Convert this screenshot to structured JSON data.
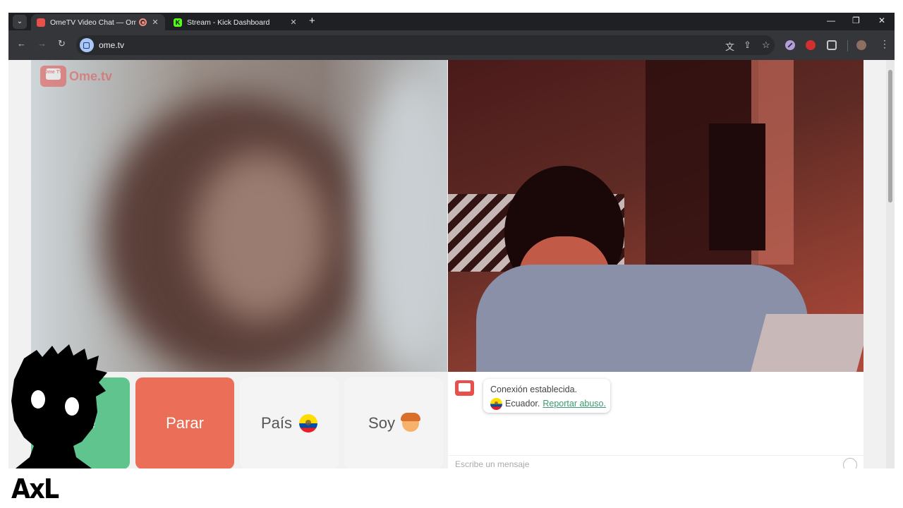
{
  "browser": {
    "tabs": [
      {
        "title": "OmeTV Video Chat — Ome",
        "active": true,
        "recording": true
      },
      {
        "title": "Stream - Kick Dashboard",
        "active": false
      }
    ],
    "url": "ome.tv"
  },
  "page": {
    "logo": {
      "badge": "Ome TV",
      "text": "Ome.tv"
    },
    "buttons": {
      "next": "ente",
      "stop": "Parar",
      "country": "País",
      "me": "Soy"
    },
    "chat": {
      "status": "Conexión establecida.",
      "country": "Ecuador.",
      "report_link": "Reportar abuso.",
      "placeholder": "Escribe un mensaje"
    }
  },
  "overlay": {
    "brand": "AxL"
  },
  "colors": {
    "next": "#5fc48e",
    "stop": "#eb6f58",
    "brand_red": "#e8504c",
    "link": "#3c9a6e"
  },
  "icons": [
    "tab-search-icon",
    "back-icon",
    "forward-icon",
    "reload-icon",
    "translate-icon",
    "install-icon",
    "bookmark-star-icon",
    "extensions-icon",
    "menu-icon",
    "ecuador-flag-icon",
    "person-emoji-icon",
    "smiley-icon"
  ]
}
